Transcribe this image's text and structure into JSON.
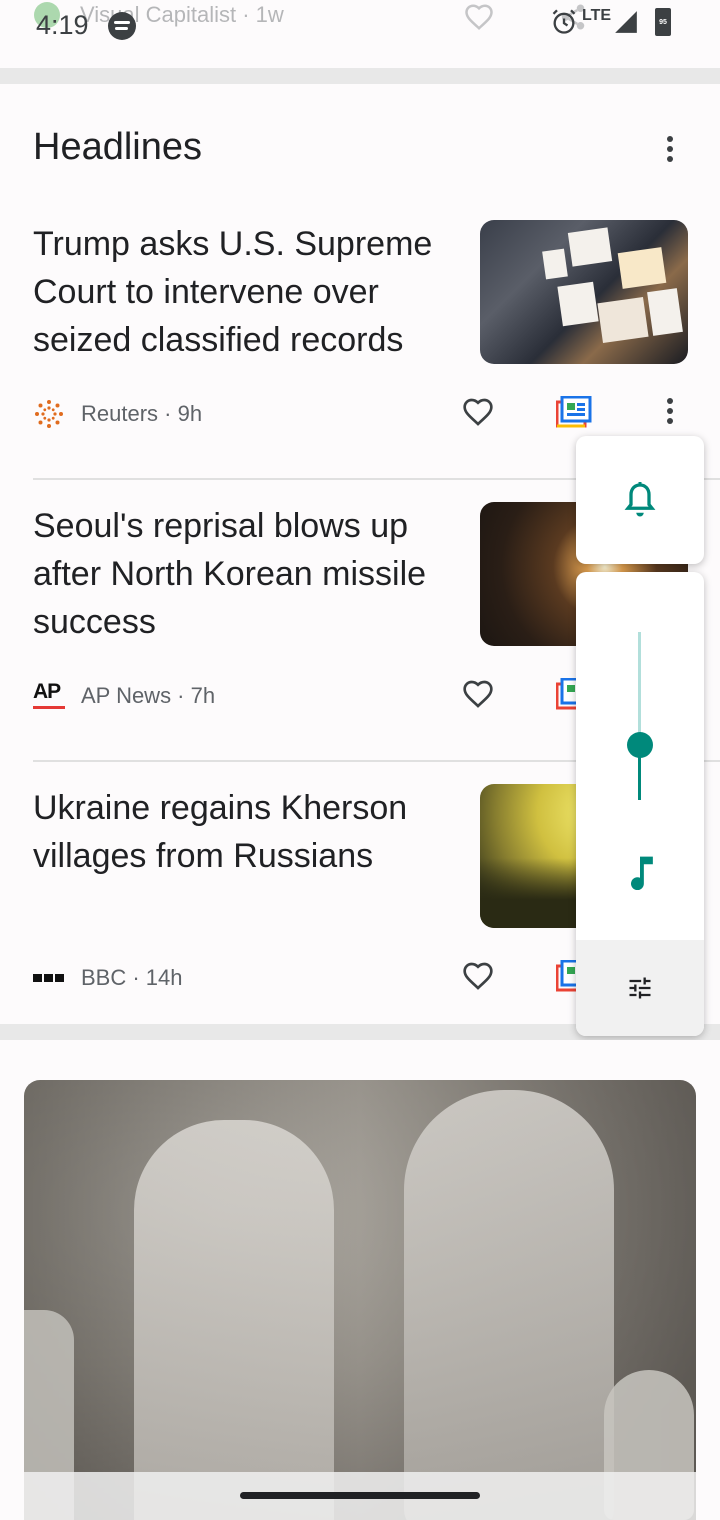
{
  "status_bar": {
    "time": "4:19",
    "network": "LTE",
    "battery": "95"
  },
  "peek_card": {
    "source": "Visual Capitalist · 1w"
  },
  "headlines": {
    "title": "Headlines",
    "articles": [
      {
        "headline": "Trump asks U.S. Supreme Court to intervene over seized classified records",
        "source": "Reuters",
        "age": "9h",
        "meta": "Reuters · 9h"
      },
      {
        "headline": "Seoul's reprisal blows up after North Korean missile success",
        "source": "AP News",
        "age": "7h",
        "meta": "AP News · 7h",
        "logo_text": "AP"
      },
      {
        "headline": "Ukraine regains Kherson villages from Russians",
        "source": "BBC",
        "age": "14h",
        "meta": "BBC · 14h"
      }
    ]
  },
  "volume_panel": {
    "level": 0.33,
    "accent": "#00897b",
    "track": "#b2dfdb"
  },
  "icons": [
    "spotify-icon",
    "alarm-icon",
    "signal-icon",
    "battery-icon",
    "more-vert-icon",
    "heart-icon",
    "full-coverage-icon",
    "bell-icon",
    "music-note-icon",
    "tune-icon"
  ]
}
